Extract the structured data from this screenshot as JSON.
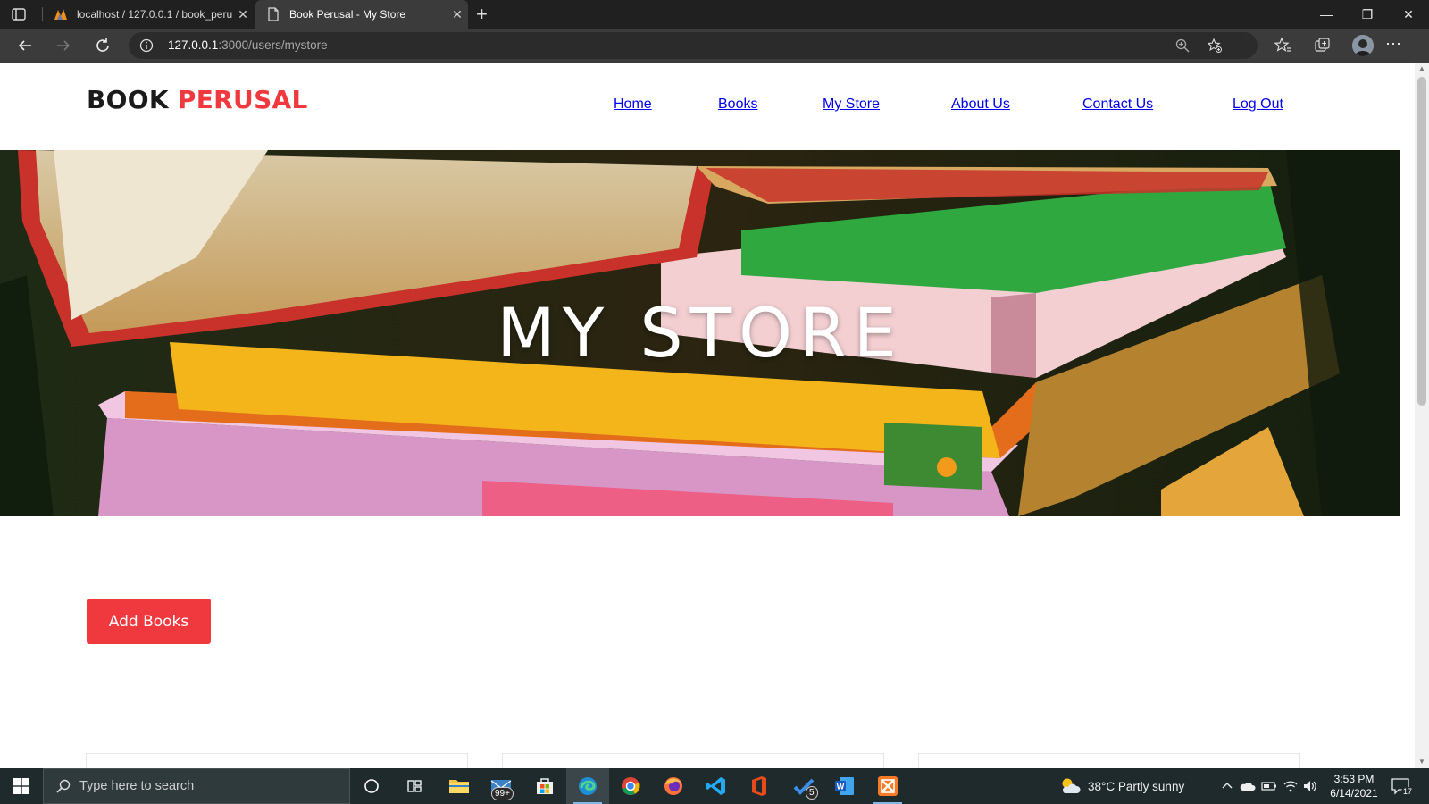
{
  "browser": {
    "tabs": [
      {
        "title": "localhost / 127.0.0.1 / book_perusal",
        "active": false
      },
      {
        "title": "Book Perusal - My Store",
        "active": true
      }
    ],
    "url_host": "127.0.0.1",
    "url_rest": ":3000/users/mystore"
  },
  "site": {
    "logo_part1": "BOOK",
    "logo_part2": "PERUSAL",
    "nav": [
      "Home",
      "Books",
      "My Store",
      "About Us",
      "Contact Us",
      "Log Out"
    ],
    "hero_title": "MY STORE",
    "add_button": "Add Books",
    "accent_color": "#f0383f"
  },
  "taskbar": {
    "search_placeholder": "Type here to search",
    "mail_badge": "99+",
    "todo_badge": "5",
    "weather": "38°C  Partly sunny",
    "time": "3:53 PM",
    "date": "6/14/2021",
    "notifications": "17"
  }
}
